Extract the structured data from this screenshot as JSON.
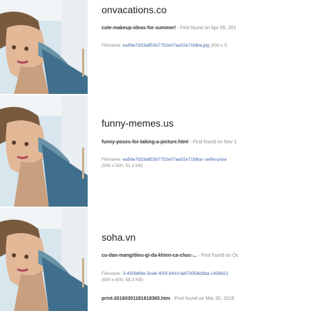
{
  "results": [
    {
      "domain": "onvacations.co",
      "path": "cute-makeup-ideas-for-summer/",
      "first_found": "- First found on Apr 09, 201",
      "filename_label": "Filename:",
      "filename_hash": "ea56e7d33a853b7752e07aa02e71fdba.jpg",
      "filename_size": "(500 x 5"
    },
    {
      "domain": "funny-memes.us",
      "path": "funny-poses-for-taking-a-picture.html",
      "first_found": "- First found on Nov 1",
      "filename_label": "Filename:",
      "filename_hash": "ea56e7d33a853b7752e07aa02e71fdba--selfie-pose",
      "filename_size": "(500 x 500, 51.2 KB)"
    },
    {
      "domain": "soha.vn",
      "path": "cu-dan-mang/dieu-gi-da-khien-ca-chuc-...",
      "first_found": "- First found on Oc",
      "filename_label": "Filename:",
      "filename_hash": "3-45f3d69e-5ca6-450f-8403-fa873058d3ba-1456821",
      "filename_size": "(600 x 600, 68.3 KB)"
    },
    {
      "path": "print-20160301181818365.htm",
      "first_found": "- First found on Mar 30, 2019"
    }
  ]
}
